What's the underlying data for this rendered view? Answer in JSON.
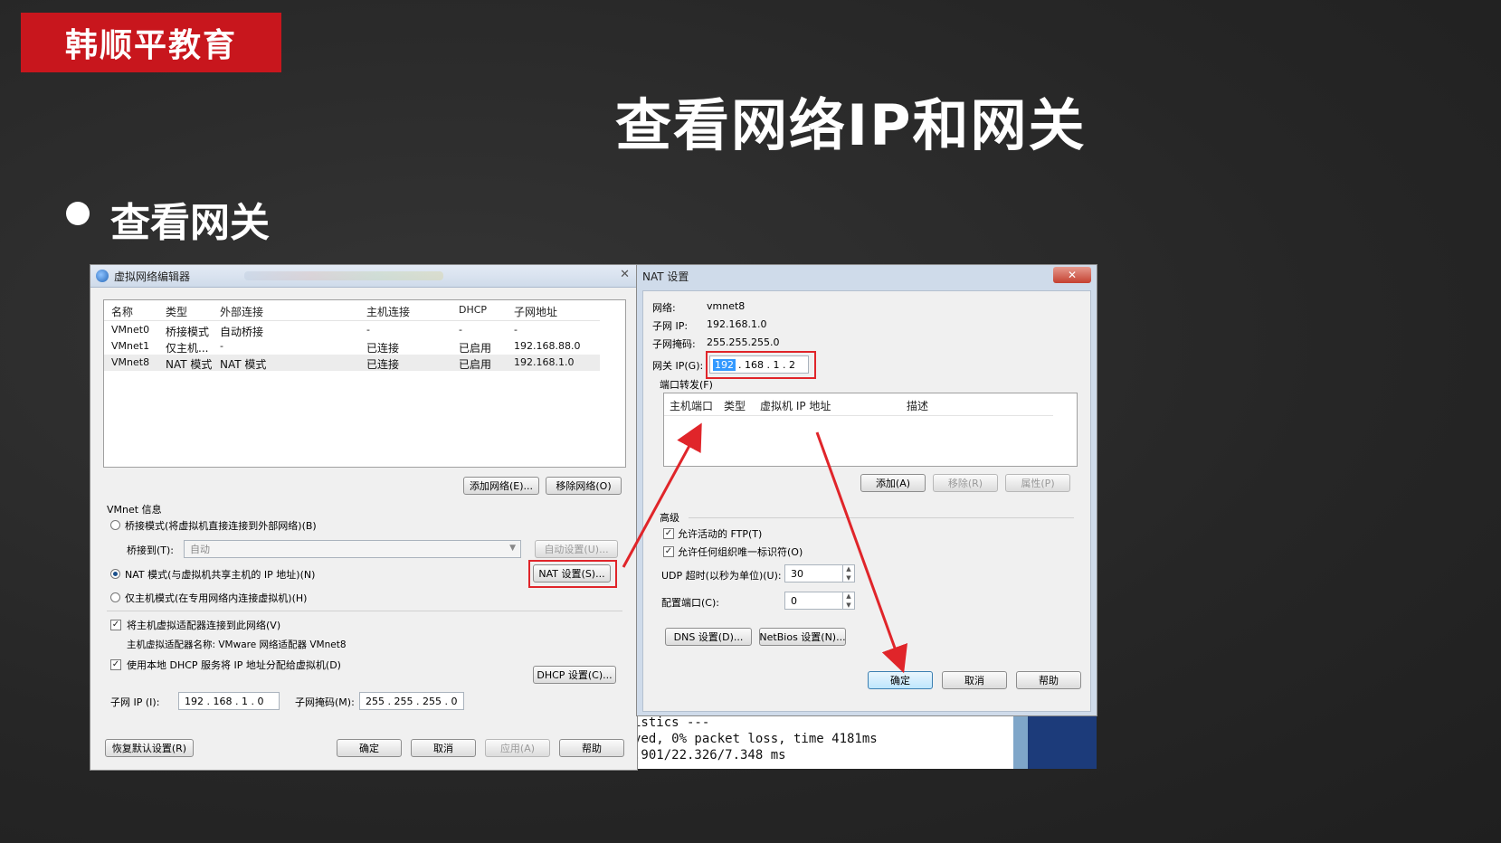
{
  "brand": "韩顺平教育",
  "slide_title": "查看网络IP和网关",
  "bullet": "查看网关",
  "vne": {
    "title": "虚拟网络编辑器",
    "columns": [
      "名称",
      "类型",
      "外部连接",
      "主机连接",
      "DHCP",
      "子网地址"
    ],
    "rows": [
      [
        "VMnet0",
        "桥接模式",
        "自动桥接",
        "-",
        "-",
        "-"
      ],
      [
        "VMnet1",
        "仅主机...",
        "-",
        "已连接",
        "已启用",
        "192.168.88.0"
      ],
      [
        "VMnet8",
        "NAT 模式",
        "NAT 模式",
        "已连接",
        "已启用",
        "192.168.1.0"
      ]
    ],
    "add_network": "添加网络(E)...",
    "remove_network": "移除网络(O)",
    "vmnet_info": "VMnet 信息",
    "bridge_mode": "桥接模式(将虚拟机直接连接到外部网络)(B)",
    "bridge_to_label": "桥接到(T):",
    "bridge_to_value": "自动",
    "auto_settings": "自动设置(U)...",
    "nat_mode": "NAT 模式(与虚拟机共享主机的 IP 地址)(N)",
    "nat_settings": "NAT 设置(S)...",
    "host_only_mode": "仅主机模式(在专用网络内连接虚拟机)(H)",
    "connect_adapter": "将主机虚拟适配器连接到此网络(V)",
    "adapter_name": "主机虚拟适配器名称: VMware 网络适配器 VMnet8",
    "use_dhcp": "使用本地 DHCP 服务将 IP 地址分配给虚拟机(D)",
    "dhcp_settings": "DHCP 设置(C)...",
    "subnet_ip_label": "子网 IP (I):",
    "subnet_ip": "192 . 168 .  1  .  0",
    "subnet_mask_label": "子网掩码(M):",
    "subnet_mask": "255 . 255 . 255 .  0",
    "restore_defaults": "恢复默认设置(R)",
    "ok": "确定",
    "cancel": "取消",
    "apply": "应用(A)",
    "help": "帮助"
  },
  "nat": {
    "title": "NAT 设置",
    "network_label": "网络:",
    "network_value": "vmnet8",
    "subnet_ip_label": "子网 IP:",
    "subnet_ip_value": "192.168.1.0",
    "subnet_mask_label": "子网掩码:",
    "subnet_mask_value": "255.255.255.0",
    "gateway_label": "网关 IP(G):",
    "gateway_selected": "192",
    "gateway_rest": ". 168 .  1  .  2",
    "port_forwarding": "端口转发(F)",
    "pf_columns": [
      "主机端口",
      "类型",
      "虚拟机 IP 地址",
      "描述"
    ],
    "add": "添加(A)",
    "remove": "移除(R)",
    "properties": "属性(P)",
    "advanced": "高级",
    "allow_ftp": "允许活动的 FTP(T)",
    "allow_any_oui": "允许任何组织唯一标识符(O)",
    "udp_timeout_label": "UDP 超时(以秒为单位)(U):",
    "udp_timeout": "30",
    "config_port_label": "配置端口(C):",
    "config_port": "0",
    "dns_settings": "DNS 设置(D)...",
    "netbios_settings": "NetBios 设置(N)...",
    "ok": "确定",
    "cancel": "取消",
    "help": "帮助",
    "close_glyph": "✕"
  },
  "terminal": {
    "lines": [
      "istics ---",
      "ved, 0% packet loss, time 4181ms",
      ".901/22.326/7.348 ms"
    ]
  },
  "colors": {
    "brand_red": "#c8161d",
    "annotation_red": "#e0252a"
  }
}
